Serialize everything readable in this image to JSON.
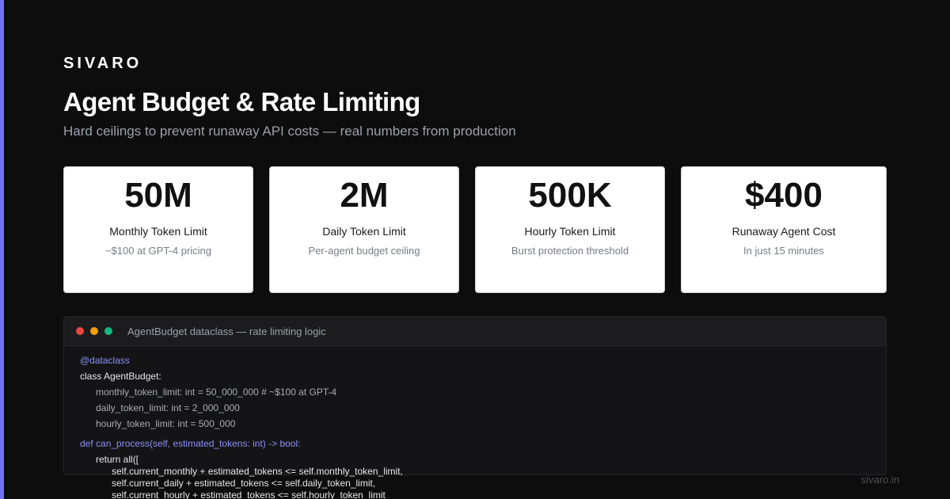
{
  "brand": "SIVARO",
  "title": "Agent Budget & Rate Limiting",
  "subtitle": "Hard ceilings to prevent runaway API costs — real numbers from production",
  "stats": [
    {
      "value": "50M",
      "label": "Monthly Token Limit",
      "note": "~$100 at GPT-4 pricing"
    },
    {
      "value": "2M",
      "label": "Daily Token Limit",
      "note": "Per-agent budget ceiling"
    },
    {
      "value": "500K",
      "label": "Hourly Token Limit",
      "note": "Burst protection threshold"
    },
    {
      "value": "$400",
      "label": "Runaway Agent Cost",
      "note": "In just 15 minutes"
    }
  ],
  "code": {
    "title": "AgentBudget dataclass — rate limiting logic",
    "lines": [
      "@dataclass",
      "class AgentBudget:",
      "monthly_token_limit: int = 50_000_000 # ~$100 at GPT-4",
      "daily_token_limit: int = 2_000_000",
      "hourly_token_limit: int = 500_000",
      "def can_process(self, estimated_tokens: int) -> bool:",
      "return all([",
      "self.current_monthly + estimated_tokens <= self.monthly_token_limit,",
      "self.current_daily + estimated_tokens <= self.daily_token_limit,",
      "self.current_hourly + estimated_tokens <= self.hourly_token_limit"
    ]
  },
  "footer": {
    "url": "sivaro.in"
  },
  "colors": {
    "accent": "#6f73f2",
    "background": "#0d0d0d",
    "dot_red": "#ef4444",
    "dot_yellow": "#f59e0b",
    "dot_green": "#10b981"
  }
}
